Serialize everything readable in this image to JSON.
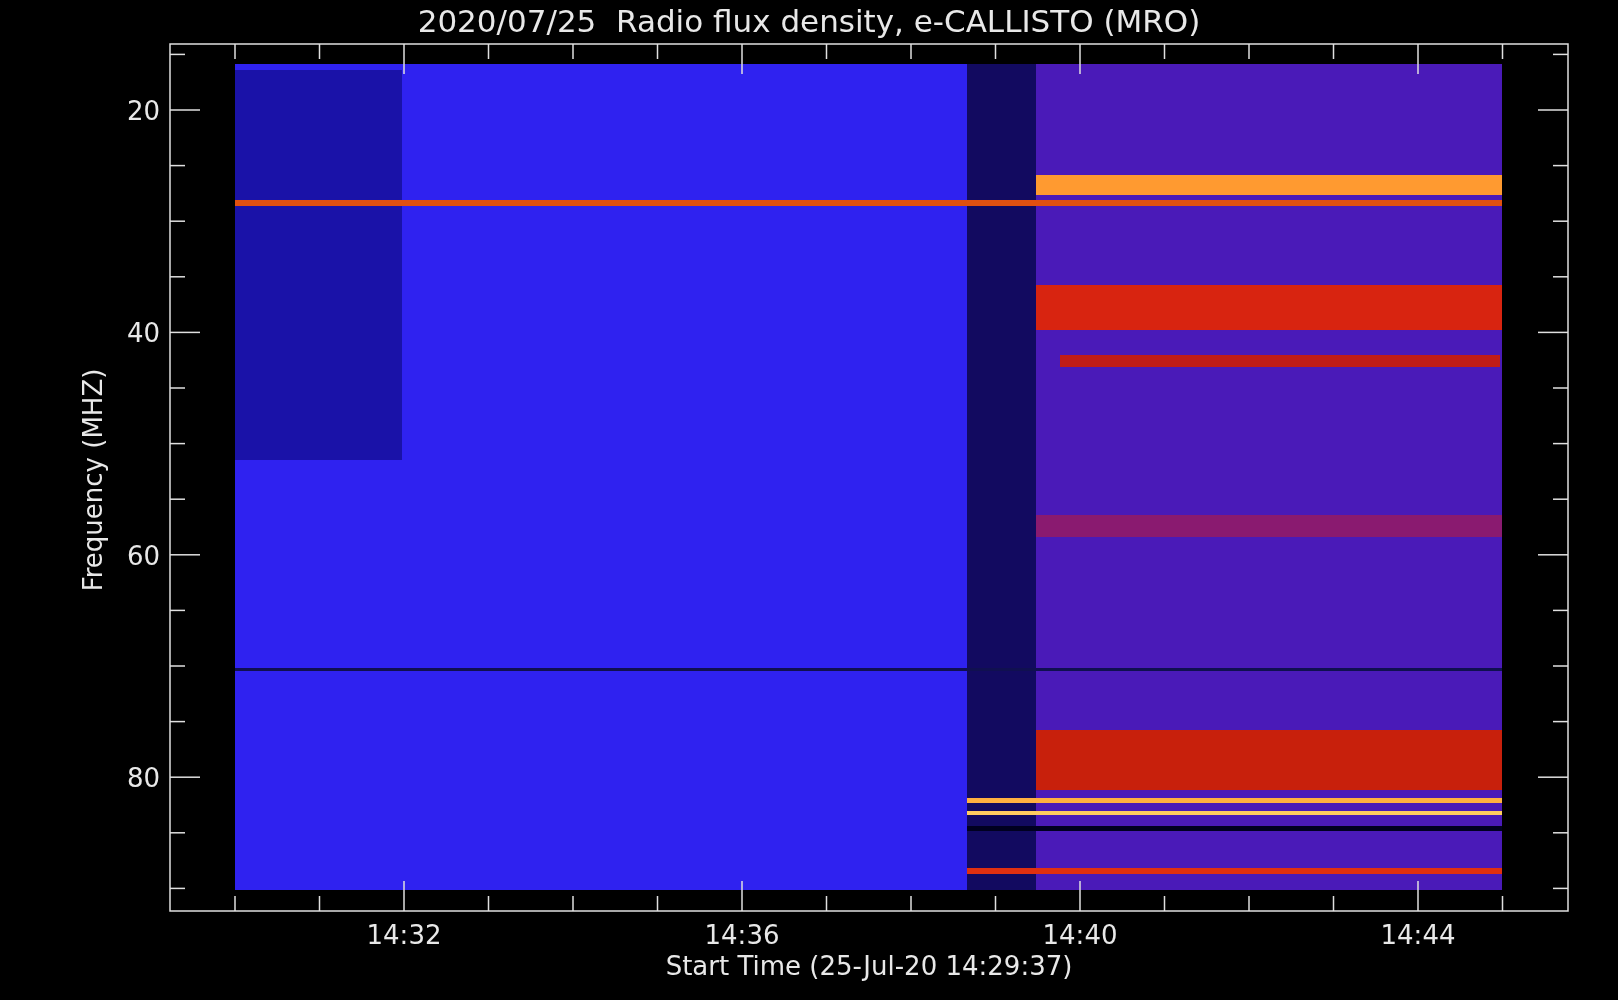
{
  "title": "2020/07/25  Radio flux density, e-CALLISTO (MRO)",
  "y_axis": {
    "label": "Frequency (MHZ)",
    "ticks": [
      "20",
      "40",
      "60",
      "80"
    ]
  },
  "x_axis": {
    "label": "Start Time (25-Jul-20 14:29:37)",
    "ticks": [
      "14:32",
      "14:36",
      "14:40",
      "14:44"
    ]
  }
}
